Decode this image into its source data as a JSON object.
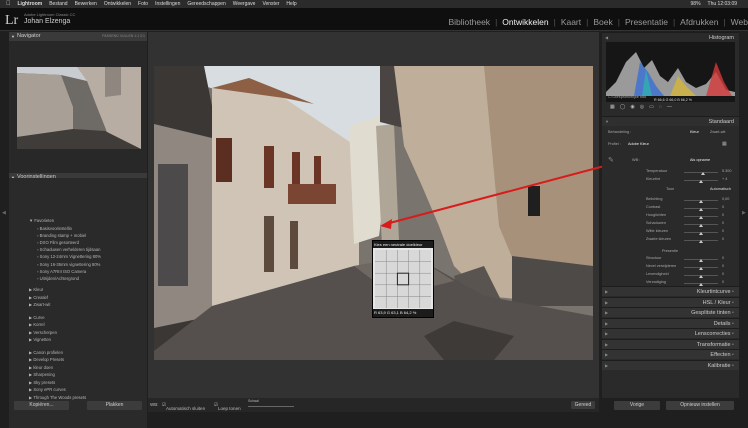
{
  "mac_menu": {
    "items": [
      "Lightroom",
      "Bestand",
      "Bewerken",
      "Ontwikkelen",
      "Foto",
      "Instellingen",
      "Gereedschappen",
      "Weergave",
      "Venster",
      "Help"
    ],
    "battery": "98%",
    "clock": "Thu 12:03:09"
  },
  "header": {
    "logo": "Lr",
    "app_name": "Adobe Lightroom Classic CC",
    "user": "Johan Elzenga",
    "modules": [
      "Bibliotheek",
      "Ontwikkelen",
      "Kaart",
      "Boek",
      "Presentatie",
      "Afdrukken",
      "Web"
    ],
    "active_module": "Ontwikkelen"
  },
  "left_panel": {
    "navigator_title": "Navigator",
    "navigator_options": "PASSEND  VULLEN  1:1  2:1",
    "presets_title": "Voorinstellingen",
    "folders": [
      {
        "label": "Favorieten",
        "open": true,
        "children": [
          "Basisvoorinstellin",
          "Branding stamp + mobiel",
          "DXO Film gesorteerd",
          "Schaduwen verhelderen tijdsaan",
          "Sony 12-24mm Vignettering 80%",
          "Sony 16-35mm vignettering 80%",
          "Sony A7RIII ISO Camera",
          "Uitrijden/Achtergrond"
        ]
      },
      {
        "label": "Kleur",
        "open": false
      },
      {
        "label": "Creatief",
        "open": false
      },
      {
        "label": "Zwart-wit",
        "open": false
      },
      {
        "label": "Curve",
        "open": false
      },
      {
        "label": "Korrel",
        "open": false
      },
      {
        "label": "Verscherpen",
        "open": false
      },
      {
        "label": "Vignetten",
        "open": false
      },
      {
        "label": "Canon profielen",
        "open": false
      },
      {
        "label": "Develop Presets",
        "open": false
      },
      {
        "label": "kleur doen",
        "open": false
      },
      {
        "label": "Sharpening",
        "open": false
      },
      {
        "label": "Sky presets",
        "open": false
      },
      {
        "label": "Sony ePR curves",
        "open": false
      },
      {
        "label": "Through The Woods presets",
        "open": false
      }
    ],
    "copy_button": "Kopiëren...",
    "paste_button": "Plakken"
  },
  "loupe": {
    "title": "Kies een neutrale doelkleur",
    "readout": "R 63,9   G 63,1   B 64,2  %"
  },
  "toolbar": {
    "wb_label": "WB:",
    "auto_dismiss": "Automatisch sluiten",
    "show_loupe": "Loep tonen",
    "scale_label": "Schaal",
    "done_button": "Gereed"
  },
  "right_panel": {
    "histogram_title": "Histogram",
    "histogram_readout": "R  66,6   G  66,0   B  66,2  %",
    "original_photo": "Oorspronkelijke foto",
    "standard_label": "Standaard",
    "treatment_label": "Behandeling :",
    "treatment_color": "Kleur",
    "treatment_bw": "Zwart-wit",
    "profile_label": "Profiel :",
    "profile_value": "Adobe Kleur",
    "wb_label": "WB :",
    "wb_value": "Als opname",
    "sliders": [
      {
        "label": "Temperatuur",
        "value": "5.300",
        "level": 0.55
      },
      {
        "label": "Kleurtint",
        "value": "+ 4",
        "level": 0.5
      }
    ],
    "tone_label": "Toon",
    "auto_label": "Automatisch",
    "tone_sliders": [
      {
        "label": "Belichting",
        "value": "0,00",
        "level": 0.5
      },
      {
        "label": "Contrast",
        "value": "0",
        "level": 0.5
      },
      {
        "label": "Hooglichten",
        "value": "0",
        "level": 0.5
      },
      {
        "label": "Schaduwen",
        "value": "0",
        "level": 0.5
      },
      {
        "label": "Witte kleuren",
        "value": "0",
        "level": 0.5
      },
      {
        "label": "Zwarte kleuren",
        "value": "0",
        "level": 0.5
      }
    ],
    "presence_label": "Presentie",
    "presence_sliders": [
      {
        "label": "Structuur",
        "value": "0",
        "level": 0.5
      },
      {
        "label": "Nevel verwijderen",
        "value": "0",
        "level": 0.5
      },
      {
        "label": "Levendigheid",
        "value": "0",
        "level": 0.5
      },
      {
        "label": "Verzadiging",
        "value": "0",
        "level": 0.5
      }
    ],
    "sections": [
      "Kleurtintcurve",
      "HSL / Kleur",
      "Gesplitste tinten",
      "Details",
      "Lenscorrecties",
      "Transformatie",
      "Effecten",
      "Kalibratie"
    ],
    "previous_button": "Vorige",
    "reset_button": "Opnieuw instellen"
  },
  "colors": {
    "accent": "#ffffff",
    "arrow": "#d81b1b",
    "panel": "#2a2a2a"
  }
}
